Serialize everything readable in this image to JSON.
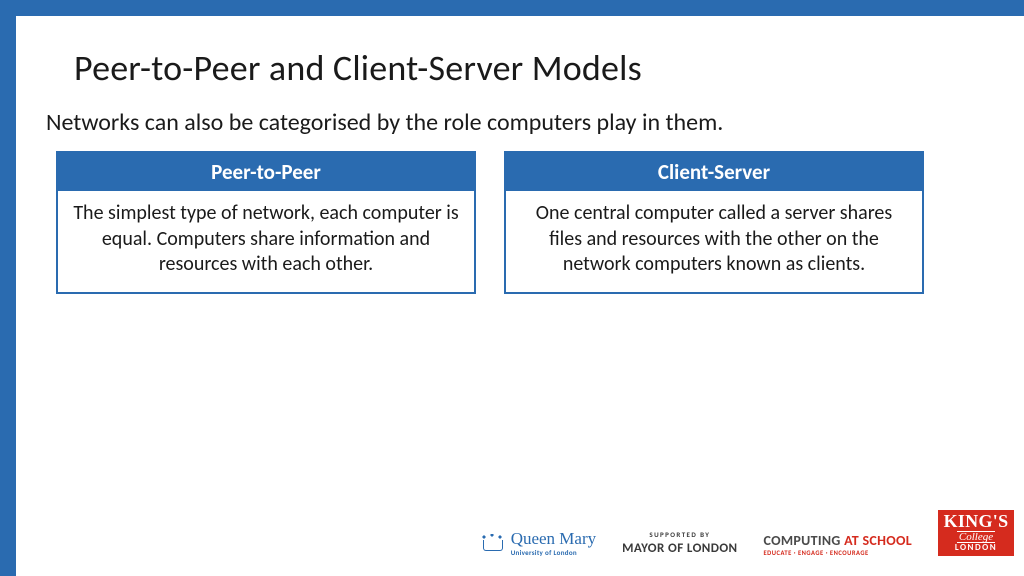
{
  "title": "Peer-to-Peer and Client-Server Models",
  "intro": "Networks can also be categorised by the role computers play in them.",
  "cards": [
    {
      "heading": "Peer-to-Peer",
      "body": "The simplest type of network, each computer is equal. Computers share information and resources with each other."
    },
    {
      "heading": "Client-Server",
      "body": "One central computer called a server shares files and resources with the other on the network computers known as clients."
    }
  ],
  "footer": {
    "qm": {
      "name": "Queen Mary",
      "sub": "University of London"
    },
    "mol": {
      "sup": "SUPPORTED BY",
      "main": "MAYOR OF LONDON"
    },
    "cas": {
      "word1": "COMPUTING ",
      "word2": "AT SCHOOL",
      "sub": "EDUCATE · ENGAGE · ENCOURAGE"
    },
    "kcl": {
      "l1": "KING'S",
      "l2": "College",
      "l3": "LONDON"
    }
  }
}
